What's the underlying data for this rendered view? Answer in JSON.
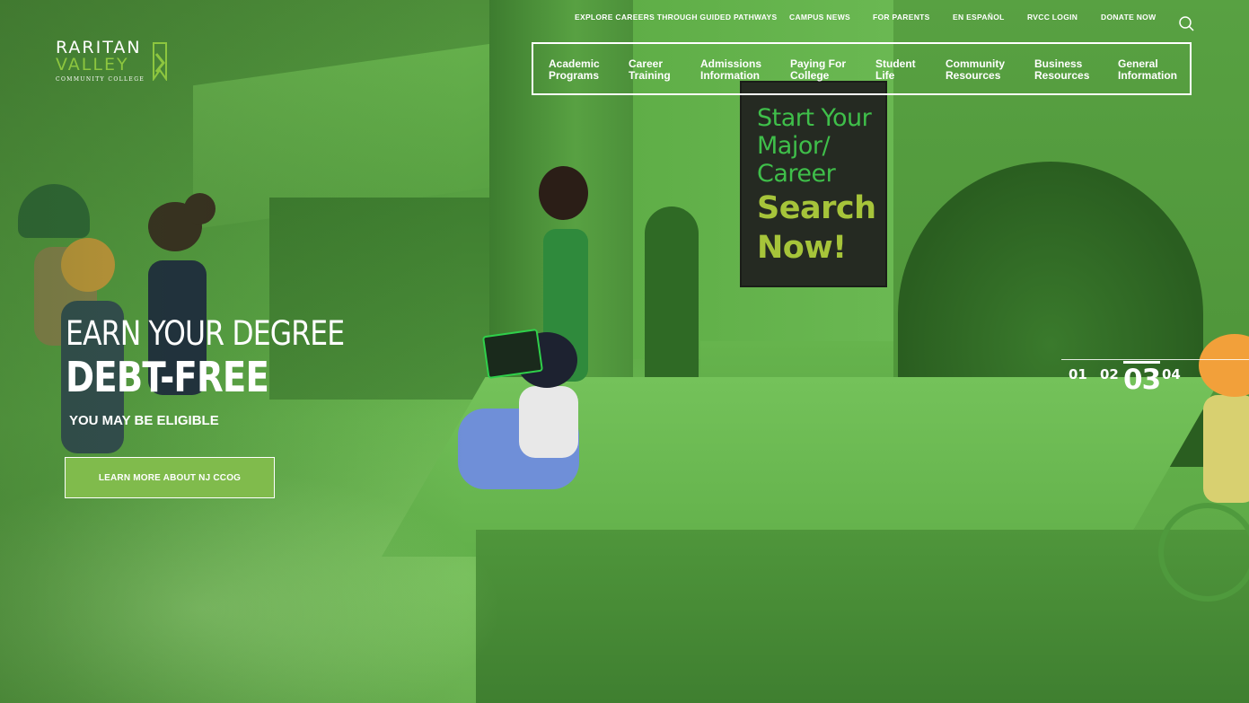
{
  "logo": {
    "line1": "RARITAN",
    "line2": "VALLEY",
    "line3": "COMMUNITY COLLEGE"
  },
  "utility_nav": [
    {
      "label": "EXPLORE CAREERS THROUGH GUIDED PATHWAYS"
    },
    {
      "label": "CAMPUS NEWS"
    },
    {
      "label": "FOR PARENTS"
    },
    {
      "label": "EN ESPAÑOL"
    },
    {
      "label": "RVCC LOGIN"
    },
    {
      "label": "DONATE NOW"
    }
  ],
  "search": {
    "icon": "search-icon"
  },
  "main_nav": [
    {
      "label": "Academic\nPrograms"
    },
    {
      "label": "Career\nTraining"
    },
    {
      "label": "Admissions\nInformation"
    },
    {
      "label": "Paying For\nCollege"
    },
    {
      "label": "Student\nLife"
    },
    {
      "label": "Community\nResources"
    },
    {
      "label": "Business\nResources"
    },
    {
      "label": "General\nInformation"
    }
  ],
  "hero": {
    "heading_line1": "EARN YOUR DEGREE",
    "heading_line2": "DEBT-FREE",
    "subheading": "YOU MAY BE ELIGIBLE",
    "cta_label": "LEARN MORE ABOUT NJ CCOG",
    "sign_line1": "Start Your",
    "sign_line2": "Major/",
    "sign_line3": "Career",
    "sign_line4": "Search",
    "sign_line5": "Now!"
  },
  "slider": {
    "pages": [
      "01",
      "02",
      "03",
      "04"
    ],
    "active": "03"
  },
  "colors": {
    "accent_green": "#8dc63f",
    "cta_green": "#80bb4c",
    "hero_green": "#5fa848"
  }
}
